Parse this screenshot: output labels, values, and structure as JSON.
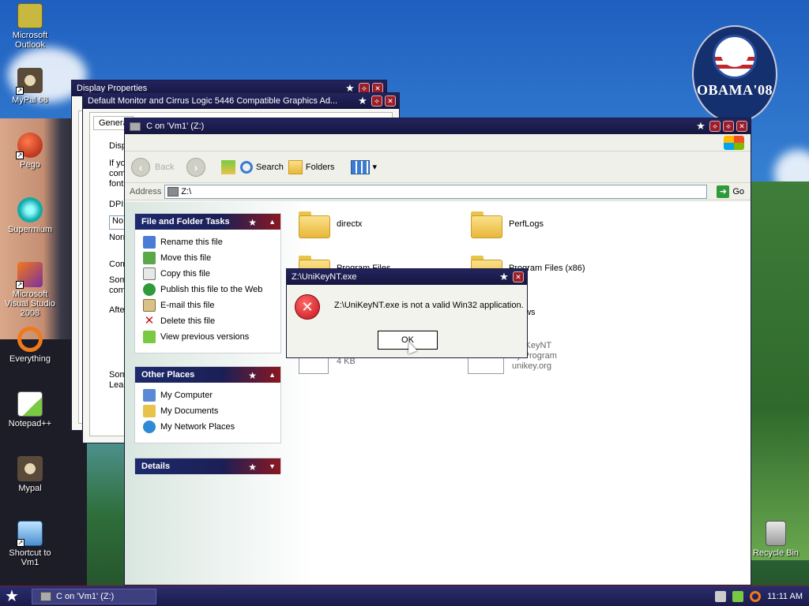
{
  "desktop": {
    "icons": [
      {
        "label": "Microsoft Outlook",
        "icon": "outlook-icon",
        "shortcut": false
      },
      {
        "label": "MyPal 68",
        "icon": "raccoon-icon",
        "shortcut": true
      },
      {
        "label": "Pego",
        "icon": "pego-icon",
        "shortcut": true
      },
      {
        "label": "Supermium",
        "icon": "supermium-icon",
        "shortcut": false
      },
      {
        "label": "Microsoft Visual Studio 2008",
        "icon": "visual-studio-icon",
        "shortcut": true
      },
      {
        "label": "Everything",
        "icon": "everything-icon",
        "shortcut": false
      },
      {
        "label": "Notepad++",
        "icon": "notepadpp-icon",
        "shortcut": false
      },
      {
        "label": "Mypal",
        "icon": "raccoon-icon",
        "shortcut": false
      },
      {
        "label": "Shortcut to Vm1",
        "icon": "vm-icon",
        "shortcut": true
      },
      {
        "label": "Recycle Bin",
        "icon": "recycle-bin-icon",
        "shortcut": false
      }
    ],
    "logo_text": "OBAMA'08"
  },
  "display_props": {
    "title": "Display Properties",
    "sub_title": "Default Monitor and Cirrus Logic 5446 Compatible Graphics Ad...",
    "tab": "Genera",
    "frag": [
      "Disp",
      "If yo",
      "com",
      "font",
      "DPI",
      "No",
      "Norm",
      "Com",
      "Som",
      "com",
      "Afte",
      "Som",
      "Lea"
    ]
  },
  "explorer": {
    "title": "C on 'Vm1' (Z:)",
    "toolbar": {
      "back": "Back",
      "search": "Search",
      "folders": "Folders"
    },
    "address": {
      "label": "Address",
      "value": "Z:\\",
      "go": "Go"
    },
    "tasks": {
      "title": "File and Folder Tasks",
      "items": [
        {
          "label": "Rename this file",
          "icon": "rename-icon"
        },
        {
          "label": "Move this file",
          "icon": "move-icon"
        },
        {
          "label": "Copy this file",
          "icon": "copy-icon"
        },
        {
          "label": "Publish this file to the Web",
          "icon": "web-publish-icon"
        },
        {
          "label": "E-mail this file",
          "icon": "email-icon"
        },
        {
          "label": "Delete this file",
          "icon": "delete-icon"
        },
        {
          "label": "View previous versions",
          "icon": "previous-versions-icon"
        }
      ]
    },
    "places": {
      "title": "Other Places",
      "items": [
        {
          "label": "My Computer",
          "icon": "my-computer-icon"
        },
        {
          "label": "My Documents",
          "icon": "my-documents-icon"
        },
        {
          "label": "My Network Places",
          "icon": "network-places-icon"
        }
      ]
    },
    "details": {
      "title": "Details"
    },
    "files": [
      {
        "name": "directx",
        "type": "folder"
      },
      {
        "name": "PerfLogs",
        "type": "folder"
      },
      {
        "name": "Program Files",
        "type": "folder"
      },
      {
        "name": "Program Files (x86)",
        "type": "folder"
      },
      {
        "name": "ows",
        "type": "folder"
      },
      {
        "size": "4 KB",
        "type": "file"
      },
      {
        "name": "UniKeyNT",
        "desc": "ey Program",
        "company": "unikey.org",
        "type": "exe"
      }
    ]
  },
  "dialog": {
    "title": "Z:\\UniKeyNT.exe",
    "message": "Z:\\UniKeyNT.exe is not a valid Win32 application.",
    "ok": "OK"
  },
  "taskbar": {
    "button": "C on 'Vm1' (Z:)",
    "clock": "11:11 AM"
  },
  "colors": {
    "title_bar": "#1b1c4e",
    "accent_red": "#b01c2a",
    "error_red": "#c4121a"
  }
}
